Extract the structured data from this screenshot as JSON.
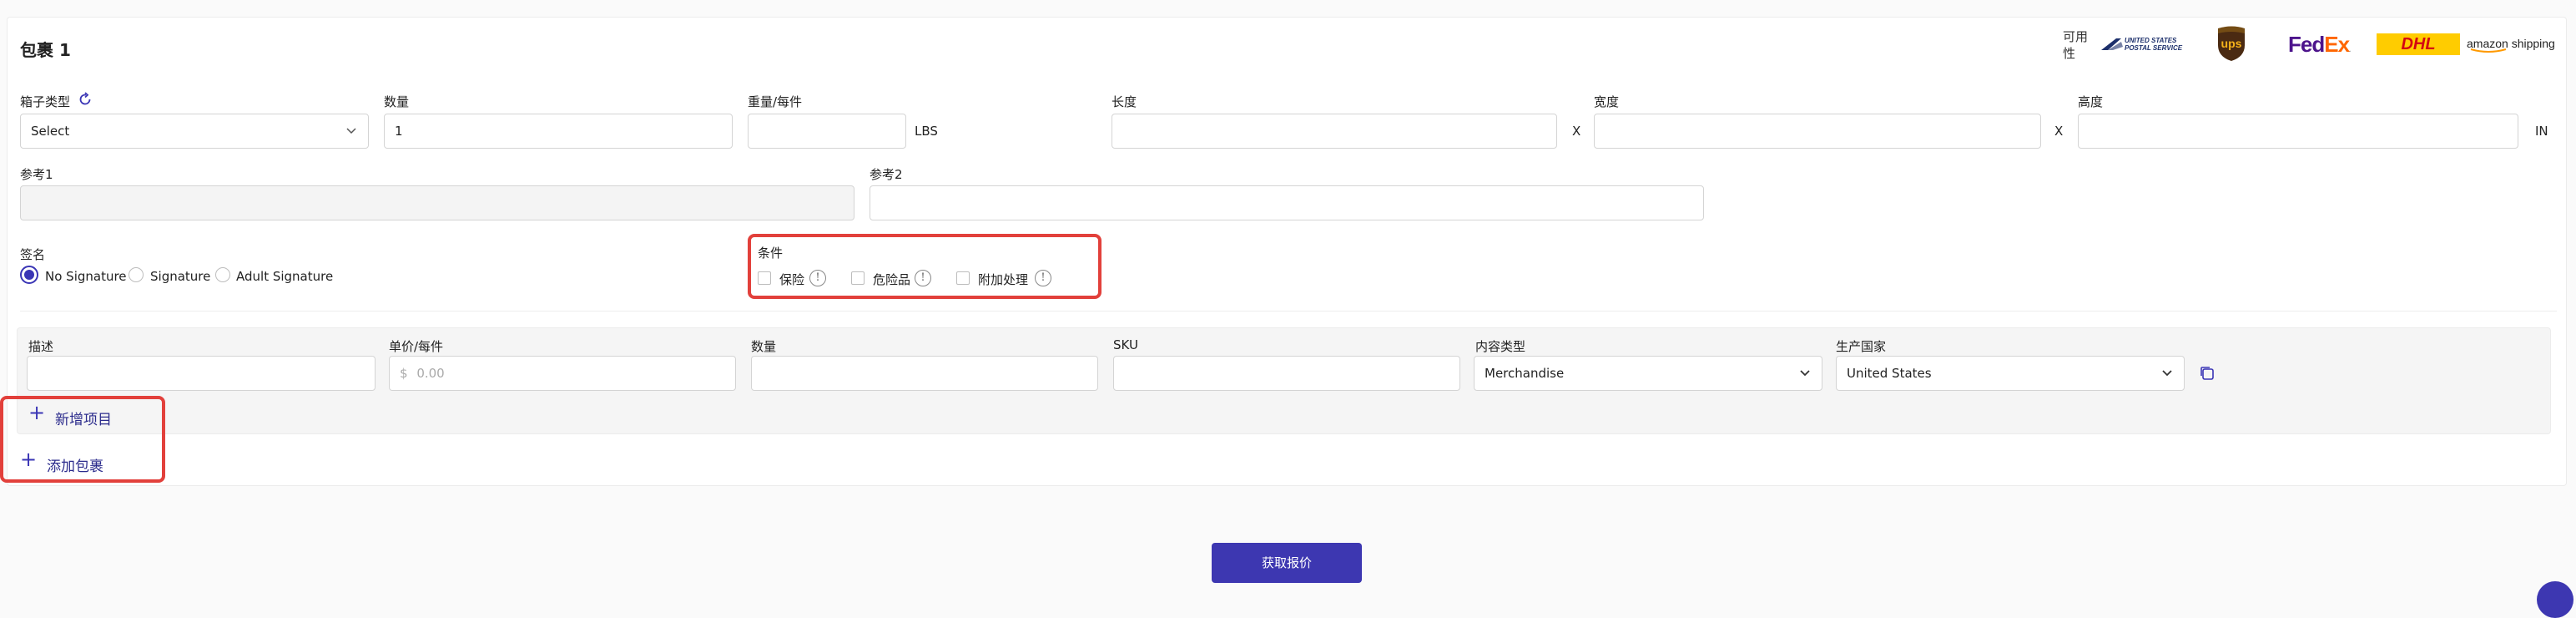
{
  "package": {
    "title": "包裹 1",
    "availability_label": "可用性",
    "carriers": [
      {
        "name": "United States Postal Service",
        "text": "UNITED STATES POSTAL SERVICE"
      },
      {
        "name": "UPS",
        "text": "ups"
      },
      {
        "name": "FedEx",
        "text": "FedEx"
      },
      {
        "name": "DHL",
        "text": "DHL"
      },
      {
        "name": "Amazon Shipping",
        "text": "amazon shipping"
      }
    ],
    "box_type": {
      "label": "箱子类型",
      "value": "Select"
    },
    "quantity": {
      "label": "数量",
      "value": "1"
    },
    "weight": {
      "label": "重量/每件",
      "value": "",
      "unit": "LBS"
    },
    "length": {
      "label": "长度",
      "value": ""
    },
    "width": {
      "label": "宽度",
      "value": ""
    },
    "height": {
      "label": "高度",
      "value": "",
      "unit": "IN"
    },
    "dim_separator": "X",
    "ref1": {
      "label": "参考1",
      "value": ""
    },
    "ref2": {
      "label": "参考2",
      "value": ""
    },
    "signature": {
      "label": "签名",
      "options": [
        "No Signature",
        "Signature",
        "Adult Signature"
      ],
      "selected": "No Signature"
    },
    "conditions": {
      "label": "条件",
      "options": [
        "保险",
        "危险品",
        "附加处理"
      ],
      "info_glyph": "!"
    }
  },
  "items": {
    "description": {
      "label": "描述",
      "value": ""
    },
    "unit_price": {
      "label": "单价/每件",
      "prefix": "$",
      "placeholder": "0.00"
    },
    "quantity": {
      "label": "数量",
      "value": ""
    },
    "sku": {
      "label": "SKU",
      "value": ""
    },
    "content_type": {
      "label": "内容类型",
      "value": "Merchandise"
    },
    "origin_country": {
      "label": "生产国家",
      "value": "United States"
    },
    "add_item_label": "新增项目"
  },
  "add_package_label": "添加包裹",
  "get_quote_label": "获取报价",
  "colors": {
    "accent": "#3d37b1",
    "highlight": "#e2403b"
  }
}
